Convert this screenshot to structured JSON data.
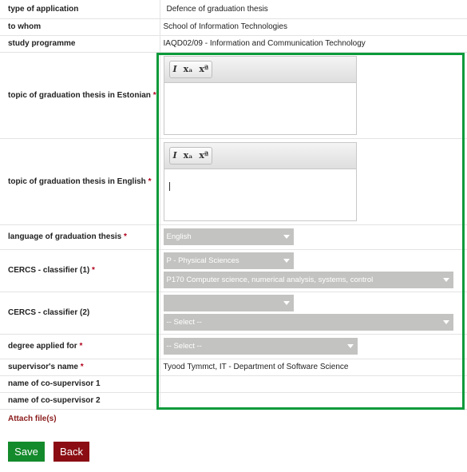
{
  "rows": {
    "type": {
      "label": "type of application",
      "value": "Defence of graduation thesis"
    },
    "whom": {
      "label": "to whom",
      "value": "School of Information Technologies"
    },
    "programme": {
      "label": "study programme",
      "value": "IAQD02/09 - Information and Communication Technology"
    },
    "topic_et": {
      "label": "topic of graduation thesis in Estonian",
      "value": ""
    },
    "topic_en": {
      "label": "topic of graduation thesis in English",
      "value": ""
    },
    "language": {
      "label": "language of graduation thesis",
      "value": "English"
    },
    "cercs1": {
      "label": "CERCS - classifier (1)",
      "value_top": "P - Physical Sciences",
      "value_bottom": "P170 Computer science, numerical analysis, systems, control"
    },
    "cercs2": {
      "label": "CERCS - classifier (2)",
      "value_top": "",
      "value_bottom": "-- Select --"
    },
    "degree": {
      "label": "degree applied for",
      "value": "-- Select --"
    },
    "supervisor": {
      "label": "supervisor's name",
      "value": "Tyood Tymmct, IT - Department of Software Science"
    },
    "cosup1": {
      "label": "name of co-supervisor 1",
      "value": ""
    },
    "cosup2": {
      "label": "name of co-supervisor 2",
      "value": ""
    }
  },
  "required_mark": "*",
  "editor_toolbar": {
    "italic": "I",
    "subscript": "xₐ",
    "superscript": "xª"
  },
  "attach_label": "Attach file(s)",
  "buttons": {
    "save": "Save",
    "back": "Back"
  },
  "colors": {
    "save": "#138a2b",
    "back": "#8b0d13",
    "highlight": "#0b9a3a",
    "required": "#b0001c"
  },
  "icons": [
    "italic-icon",
    "subscript-icon",
    "superscript-icon",
    "chevron-down-icon"
  ]
}
